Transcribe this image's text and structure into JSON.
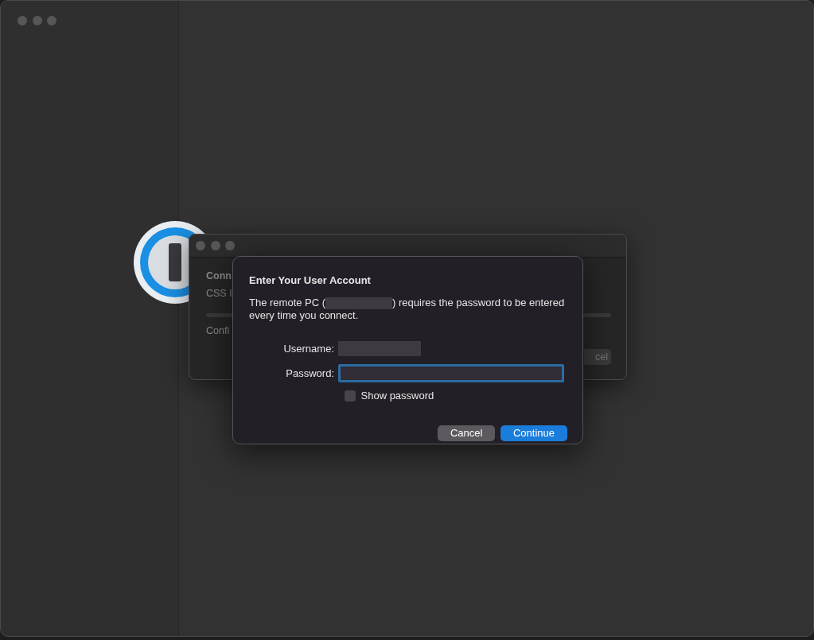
{
  "back_window": {
    "texts": [
      {
        "text": "Conn",
        "kind": "heading"
      },
      {
        "text": "CSS I",
        "kind": "sub"
      },
      {
        "text": "Confi",
        "kind": "sub"
      }
    ],
    "button": "cel"
  },
  "dialog": {
    "title": "Enter Your User Account",
    "message_start": "The remote PC (",
    "message_end": ") requires the password to be entered every time you connect.",
    "fields": [
      {
        "label": "Username:",
        "kind": "redacted"
      },
      {
        "label": "Password:",
        "kind": "input",
        "focused": true
      }
    ],
    "show_password": {
      "label": "Show password",
      "checked": false
    },
    "buttons": [
      {
        "label": "Cancel",
        "kind": "secondary"
      },
      {
        "label": "Continue",
        "kind": "primary"
      }
    ]
  }
}
